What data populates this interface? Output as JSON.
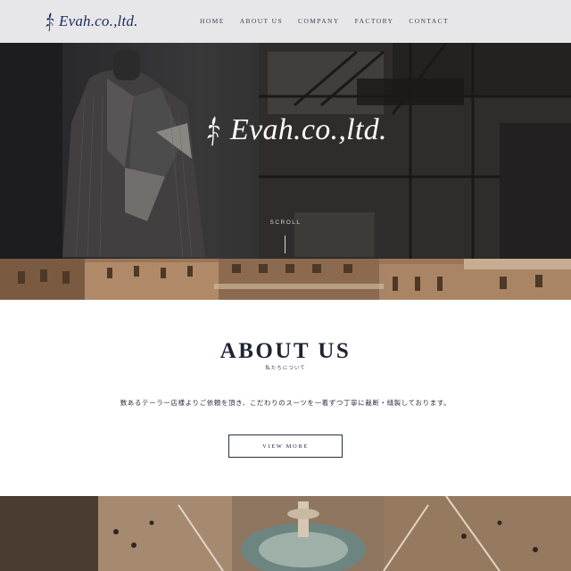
{
  "header": {
    "logo_text": "Evah.co.,ltd.",
    "logo_icon": "lily-flower-icon",
    "nav": [
      {
        "label": "HOME"
      },
      {
        "label": "ABOUT US"
      },
      {
        "label": "COMPANY"
      },
      {
        "label": "FACTORY"
      },
      {
        "label": "CONTACT"
      }
    ]
  },
  "hero": {
    "logo_text": "Evah.co.,ltd.",
    "scroll_label": "SCROLL"
  },
  "about": {
    "title": "ABOUT US",
    "subtitle": "私たちについて",
    "text": "数あるテーラー店様よりご依頼を頂き、こだわりのスーツを一着ずつ丁寧に裁断・縫製しております。",
    "button_label": "VIEW MORE"
  },
  "colors": {
    "brand_navy": "#1d2a5c",
    "header_bg": "#e7e7ea",
    "text_dark": "#1f2433"
  }
}
